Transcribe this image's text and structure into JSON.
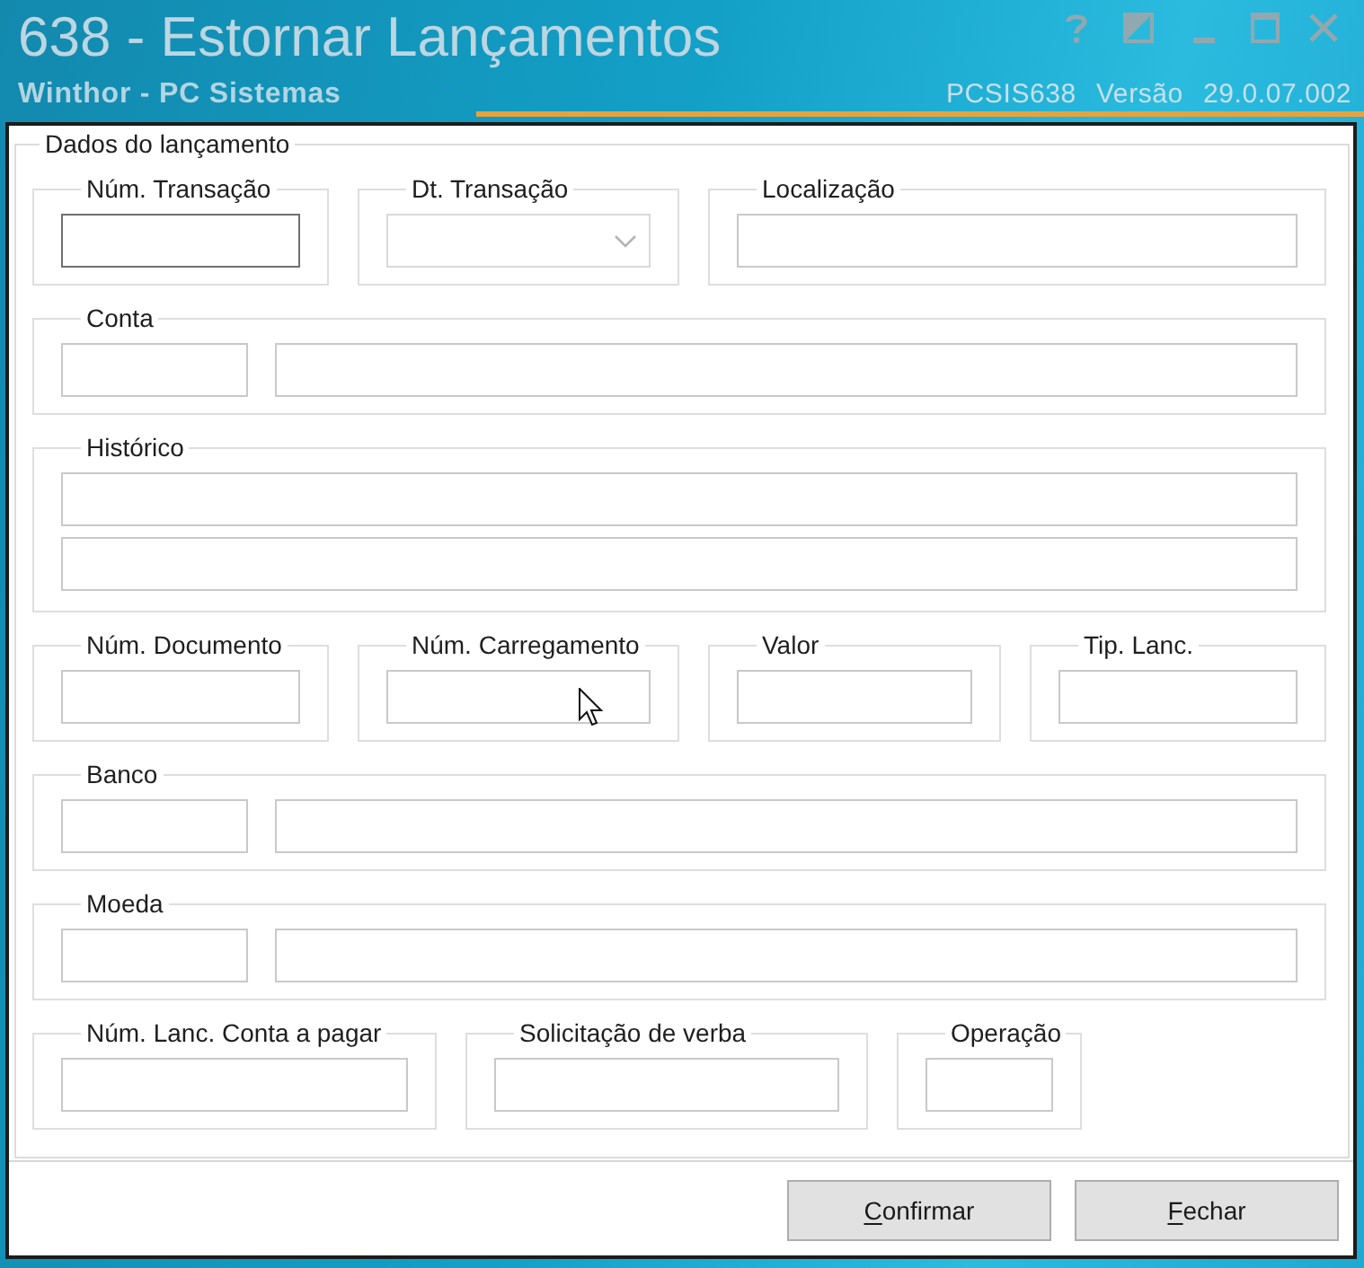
{
  "window": {
    "title": "638 - Estornar Lançamentos",
    "subtitle": "Winthor - PC Sistemas",
    "program": "PCSIS638",
    "version_label": "Versão",
    "version": "29.0.07.002"
  },
  "form": {
    "title": "Dados do lançamento",
    "groups": [
      {
        "label": "Núm. Transação",
        "kind": "single",
        "fields": [
          {
            "kind": "text",
            "focused": true
          }
        ]
      },
      {
        "label": "Dt. Transação",
        "kind": "single",
        "fields": [
          {
            "kind": "dropdown",
            "focused": false
          }
        ]
      },
      {
        "label": "Localização",
        "kind": "single",
        "fields": [
          {
            "kind": "text",
            "focused": false
          }
        ]
      },
      {
        "label": "Conta",
        "kind": "pair",
        "fields": [
          {
            "kind": "text",
            "focused": false
          },
          {
            "kind": "text",
            "focused": false
          }
        ]
      },
      {
        "label": "Histórico",
        "kind": "stacked",
        "fields": [
          {
            "kind": "text",
            "focused": false
          },
          {
            "kind": "text",
            "focused": false
          }
        ]
      },
      {
        "label": "Núm. Documento",
        "kind": "single",
        "fields": [
          {
            "kind": "text",
            "focused": false
          }
        ]
      },
      {
        "label": "Núm. Carregamento",
        "kind": "single",
        "fields": [
          {
            "kind": "text",
            "focused": false
          }
        ]
      },
      {
        "label": "Valor",
        "kind": "single",
        "fields": [
          {
            "kind": "text",
            "focused": false
          }
        ]
      },
      {
        "label": "Tip. Lanc.",
        "kind": "single",
        "fields": [
          {
            "kind": "text",
            "focused": false
          }
        ]
      },
      {
        "label": "Banco",
        "kind": "pair",
        "fields": [
          {
            "kind": "text",
            "focused": false
          },
          {
            "kind": "text",
            "focused": false
          }
        ]
      },
      {
        "label": "Moeda",
        "kind": "pair",
        "fields": [
          {
            "kind": "text",
            "focused": false
          },
          {
            "kind": "text",
            "focused": false
          }
        ]
      },
      {
        "label": "Núm. Lanc. Conta a pagar",
        "kind": "single",
        "fields": [
          {
            "kind": "text",
            "focused": false
          }
        ]
      },
      {
        "label": "Solicitação de verba",
        "kind": "single",
        "fields": [
          {
            "kind": "text",
            "focused": false
          }
        ]
      },
      {
        "label": "Operação",
        "kind": "single",
        "fields": [
          {
            "kind": "text",
            "focused": false
          }
        ]
      }
    ]
  },
  "buttons": [
    {
      "label": "Confirmar",
      "underlined_initial": true
    },
    {
      "label": "Fechar",
      "underlined_initial": true
    }
  ]
}
